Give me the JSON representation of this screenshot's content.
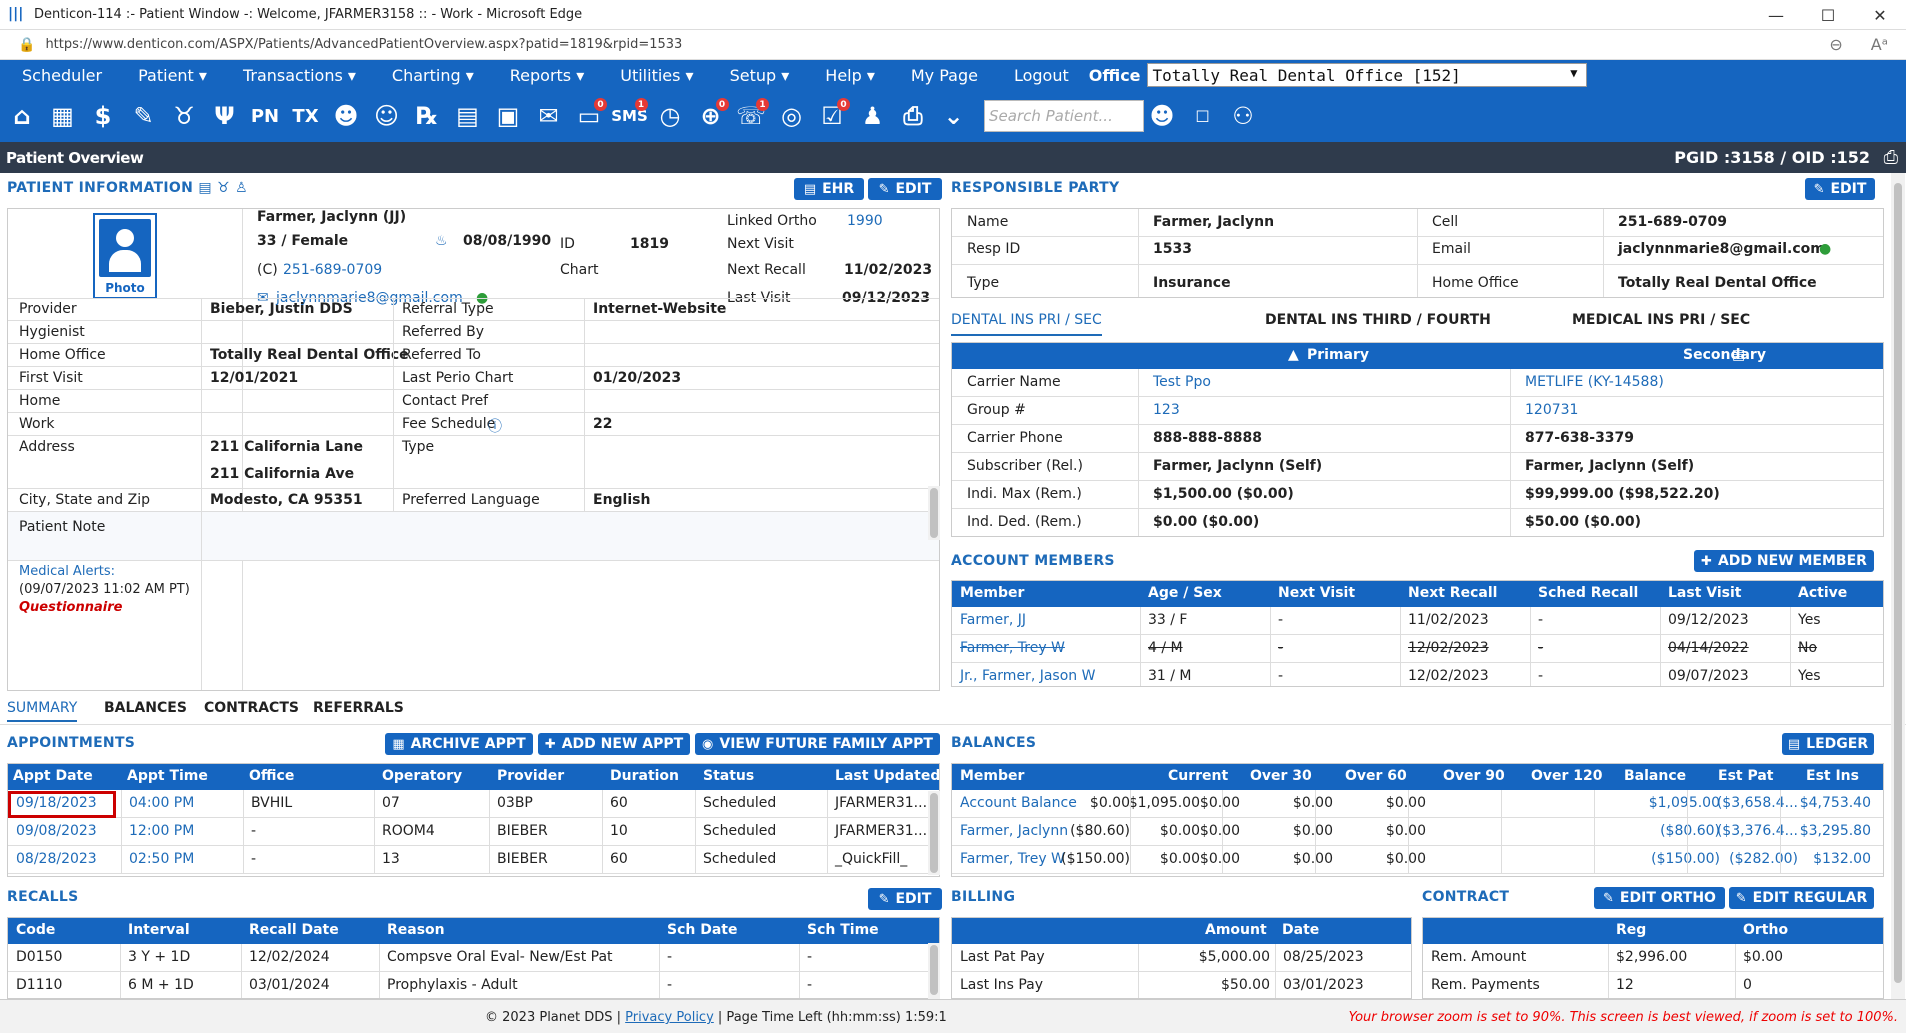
{
  "window": {
    "title": "Denticon-114 :- Patient Window -: Welcome, JFARMER3158 :: - Work - Microsoft Edge",
    "url": "https://www.denticon.com/ASPX/Patients/AdvancedPatientOverview.aspx?patid=1819&rpid=1533"
  },
  "menu": {
    "items": [
      "Scheduler",
      "Patient ▾",
      "Transactions ▾",
      "Charting ▾",
      "Reports ▾",
      "Utilities ▾",
      "Setup ▾",
      "Help ▾",
      "My Page",
      "Logout"
    ],
    "office_label": "Office",
    "office_value": "Totally Real Dental Office [152]"
  },
  "iconbar": {
    "search_placeholder": "Search Patient...",
    "badges": [
      "0",
      "1",
      "0",
      "1",
      "0"
    ],
    "icons": [
      "home-icon",
      "calendar-icon",
      "dollar-icon",
      "notes-icon",
      "tooth-icon",
      "implant-icon",
      "pn-icon",
      "tx-icon",
      "add-patient-icon",
      "add-family-icon",
      "rx-icon",
      "message-icon",
      "document-icon",
      "email-icon",
      "chat-icon",
      "sms-icon",
      "clock-icon",
      "globe-icon",
      "support-icon",
      "web-icon",
      "checklist-icon",
      "group-icon",
      "printer-icon",
      "chevron-shield-icon",
      "search-patient-icon",
      "family-search-icon"
    ],
    "icon_labels": {
      "pn": "PN",
      "tx": "TX",
      "sms": "SMS",
      "rx": "℞"
    }
  },
  "header": {
    "title": "Patient Overview",
    "ids": "PGID :3158 / OID :152"
  },
  "patient": {
    "section_title": "PATIENT INFORMATION",
    "ehr_label": "EHR",
    "edit_label": "EDIT",
    "photo_label": "Photo",
    "name": "Farmer, Jaclynn (JJ)",
    "age_sex": "33 / Female",
    "dob": "08/08/1990",
    "id_label": "ID",
    "id": "1819",
    "chart_label": "Chart",
    "cell_prefix": "(C)",
    "cell": "251-689-0709",
    "email": "jaclynnmarie8@gmail.com",
    "linked_ortho_label": "Linked Ortho",
    "linked_ortho": "1990",
    "next_visit_label": "Next Visit",
    "next_recall_label": "Next Recall",
    "next_recall": "11/02/2023",
    "last_visit_label": "Last Visit",
    "last_visit": "09/12/2023",
    "rows": [
      {
        "l1": "Provider",
        "v1": "Bieber, Justin DDS",
        "l2": "Referral Type",
        "v2": "Internet-Website"
      },
      {
        "l1": "Hygienist",
        "v1": "",
        "l2": "Referred By",
        "v2": ""
      },
      {
        "l1": "Home Office",
        "v1": "Totally Real Dental Office",
        "l2": "Referred To",
        "v2": ""
      },
      {
        "l1": "First Visit",
        "v1": "12/01/2021",
        "l2": "Last Perio Chart",
        "v2": "01/20/2023"
      },
      {
        "l1": "Home",
        "v1": "",
        "l2": "Contact Pref",
        "v2": ""
      },
      {
        "l1": "Work",
        "v1": "",
        "l2": "Fee Schedule",
        "v2": "22"
      }
    ],
    "address_label": "Address",
    "address1": "211 California Lane",
    "address2": "211 California Ave",
    "type_label": "Type",
    "csz_label": "City, State and Zip",
    "csz": "Modesto, CA 95351",
    "lang_label": "Preferred Language",
    "lang": "English",
    "note_label": "Patient Note",
    "alerts_label": "Medical Alerts:",
    "alerts_time": "(09/07/2023 11:02 AM PT)",
    "alerts_q": "Questionnaire"
  },
  "responsible": {
    "section_title": "RESPONSIBLE PARTY",
    "edit_label": "EDIT",
    "name_label": "Name",
    "name": "Farmer, Jaclynn",
    "cell_label": "Cell",
    "cell": "251-689-0709",
    "respid_label": "Resp ID",
    "respid": "1533",
    "email_label": "Email",
    "email": "jaclynnmarie8@gmail.com",
    "type_label": "Type",
    "type": "Insurance",
    "homeoffice_label": "Home Office",
    "homeoffice": "Totally Real Dental Office"
  },
  "insurance": {
    "tabs": [
      "DENTAL INS PRI / SEC",
      "DENTAL INS THIRD / FOURTH",
      "MEDICAL INS PRI / SEC"
    ],
    "primary": "Primary",
    "secondary": "Secondary",
    "rows": [
      {
        "l": "Carrier Name",
        "p": "Test Ppo",
        "s": "METLIFE (KY-14588)"
      },
      {
        "l": "Group #",
        "p": "123",
        "s": "120731"
      },
      {
        "l": "Carrier Phone",
        "p": "888-888-8888",
        "s": "877-638-3379"
      },
      {
        "l": "Subscriber (Rel.)",
        "p": "Farmer, Jaclynn (Self)",
        "s": "Farmer, Jaclynn (Self)"
      },
      {
        "l": "Indi. Max (Rem.)",
        "p": "$1,500.00 ($0.00)",
        "s": "$99,999.00 ($98,522.20)"
      },
      {
        "l": "Ind. Ded. (Rem.)",
        "p": "$0.00 ($0.00)",
        "s": "$50.00 ($0.00)"
      }
    ]
  },
  "members": {
    "section_title": "ACCOUNT MEMBERS",
    "add_label": "ADD NEW MEMBER",
    "headers": [
      "Member",
      "Age / Sex",
      "Next Visit",
      "Next Recall",
      "Sched Recall",
      "Last Visit",
      "Active"
    ],
    "rows": [
      [
        "Farmer, JJ",
        "33 / F",
        "-",
        "11/02/2023",
        "-",
        "09/12/2023",
        "Yes"
      ],
      [
        "Farmer, Trey W",
        "4 / M",
        "-",
        "12/02/2023",
        "-",
        "04/14/2022",
        "No"
      ],
      [
        "Jr., Farmer, Jason W",
        "31 / M",
        "-",
        "12/02/2023",
        "-",
        "09/07/2023",
        "Yes"
      ]
    ]
  },
  "subtabs": [
    "SUMMARY",
    "BALANCES",
    "CONTRACTS",
    "REFERRALS"
  ],
  "appointments": {
    "section_title": "APPOINTMENTS",
    "archive_label": "ARCHIVE APPT",
    "add_label": "ADD NEW APPT",
    "future_label": "VIEW FUTURE FAMILY APPT",
    "headers": [
      "Appt Date",
      "Appt Time",
      "Office",
      "Operatory",
      "Provider",
      "Duration",
      "Status",
      "Last Updated"
    ],
    "rows": [
      [
        "09/18/2023",
        "04:00 PM",
        "BVHIL",
        "07",
        "03BP",
        "60",
        "Scheduled",
        "JFARMER31..."
      ],
      [
        "09/08/2023",
        "12:00 PM",
        "-",
        "ROOM4",
        "BIEBER",
        "10",
        "Scheduled",
        "JFARMER31..."
      ],
      [
        "08/28/2023",
        "02:50 PM",
        "-",
        "13",
        "BIEBER",
        "60",
        "Scheduled",
        "_QuickFill_"
      ]
    ]
  },
  "balances": {
    "section_title": "BALANCES",
    "ledger_label": "LEDGER",
    "headers": [
      "Member",
      "Current",
      "Over 30",
      "Over 60",
      "Over 90",
      "Over 120",
      "Balance",
      "Est Pat",
      "Est Ins"
    ],
    "rows": [
      [
        "Account Balance",
        "$0.00",
        "$1,095.00",
        "$0.00",
        "$0.00",
        "$0.00",
        "$1,095.00",
        "($3,658.4...",
        "$4,753.40"
      ],
      [
        "Farmer, Jaclynn",
        "($80.60)",
        "$0.00",
        "$0.00",
        "$0.00",
        "$0.00",
        "($80.60)",
        "($3,376.4...",
        "$3,295.80"
      ],
      [
        "Farmer, Trey W",
        "($150.00)",
        "$0.00",
        "$0.00",
        "$0.00",
        "$0.00",
        "($150.00)",
        "($282.00)",
        "$132.00"
      ]
    ]
  },
  "recalls": {
    "section_title": "RECALLS",
    "edit_label": "EDIT",
    "headers": [
      "Code",
      "Interval",
      "Recall Date",
      "Reason",
      "Sch Date",
      "Sch Time"
    ],
    "rows": [
      [
        "D0150",
        "3 Y + 1D",
        "12/02/2024",
        "Compsve Oral Eval- New/Est Pat",
        "-",
        "-"
      ],
      [
        "D1110",
        "6 M + 1D",
        "03/01/2024",
        "Prophylaxis - Adult",
        "-",
        "-"
      ]
    ]
  },
  "billing": {
    "section_title": "BILLING",
    "headers": [
      "Amount",
      "Date"
    ],
    "rows": [
      [
        "Last Pat Pay",
        "$5,000.00",
        "08/25/2023"
      ],
      [
        "Last Ins Pay",
        "$50.00",
        "03/01/2023"
      ]
    ]
  },
  "contract": {
    "section_title": "CONTRACT",
    "edit_ortho_label": "EDIT ORTHO",
    "edit_regular_label": "EDIT REGULAR",
    "headers": [
      "Reg",
      "Ortho"
    ],
    "rows": [
      [
        "Rem. Amount",
        "$2,996.00",
        "$0.00"
      ],
      [
        "Rem. Payments",
        "12",
        "0"
      ]
    ]
  },
  "footer": {
    "copyright": "© 2023 Planet DDS |",
    "privacy": "Privacy Policy",
    "time_left": "| Page Time Left (hh:mm:ss) 1:59:1",
    "warning": "Your browser zoom is set to 90%. This screen is best viewed, if zoom is set to 100%."
  },
  "colors": {
    "primary": "#1565c0",
    "header_dark": "#2f3b4c",
    "link": "#1e6bb8",
    "alert": "#c00"
  }
}
